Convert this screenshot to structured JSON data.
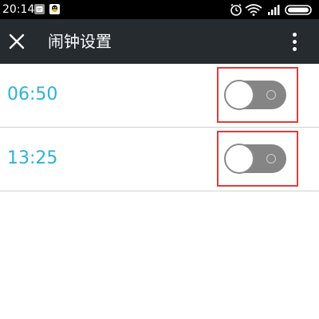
{
  "status_bar": {
    "time": "20:14",
    "notification_icons": [
      "message-icon",
      "qq-icon"
    ],
    "right_icons": [
      "alarm-clock-icon",
      "wifi-icon",
      "signal-icon",
      "battery-icon"
    ]
  },
  "header": {
    "title": "闹钟设置",
    "close_icon": "close-icon",
    "menu_icon": "more-vert-icon"
  },
  "alarms": [
    {
      "time": "06:50",
      "enabled": false
    },
    {
      "time": "13:25",
      "enabled": false
    }
  ],
  "colors": {
    "status_bar": "#000000",
    "app_bar": "#262b30",
    "time_text": "#2bb3d8",
    "toggle_off_track": "#858585",
    "highlight_box": "#e03b3b"
  }
}
